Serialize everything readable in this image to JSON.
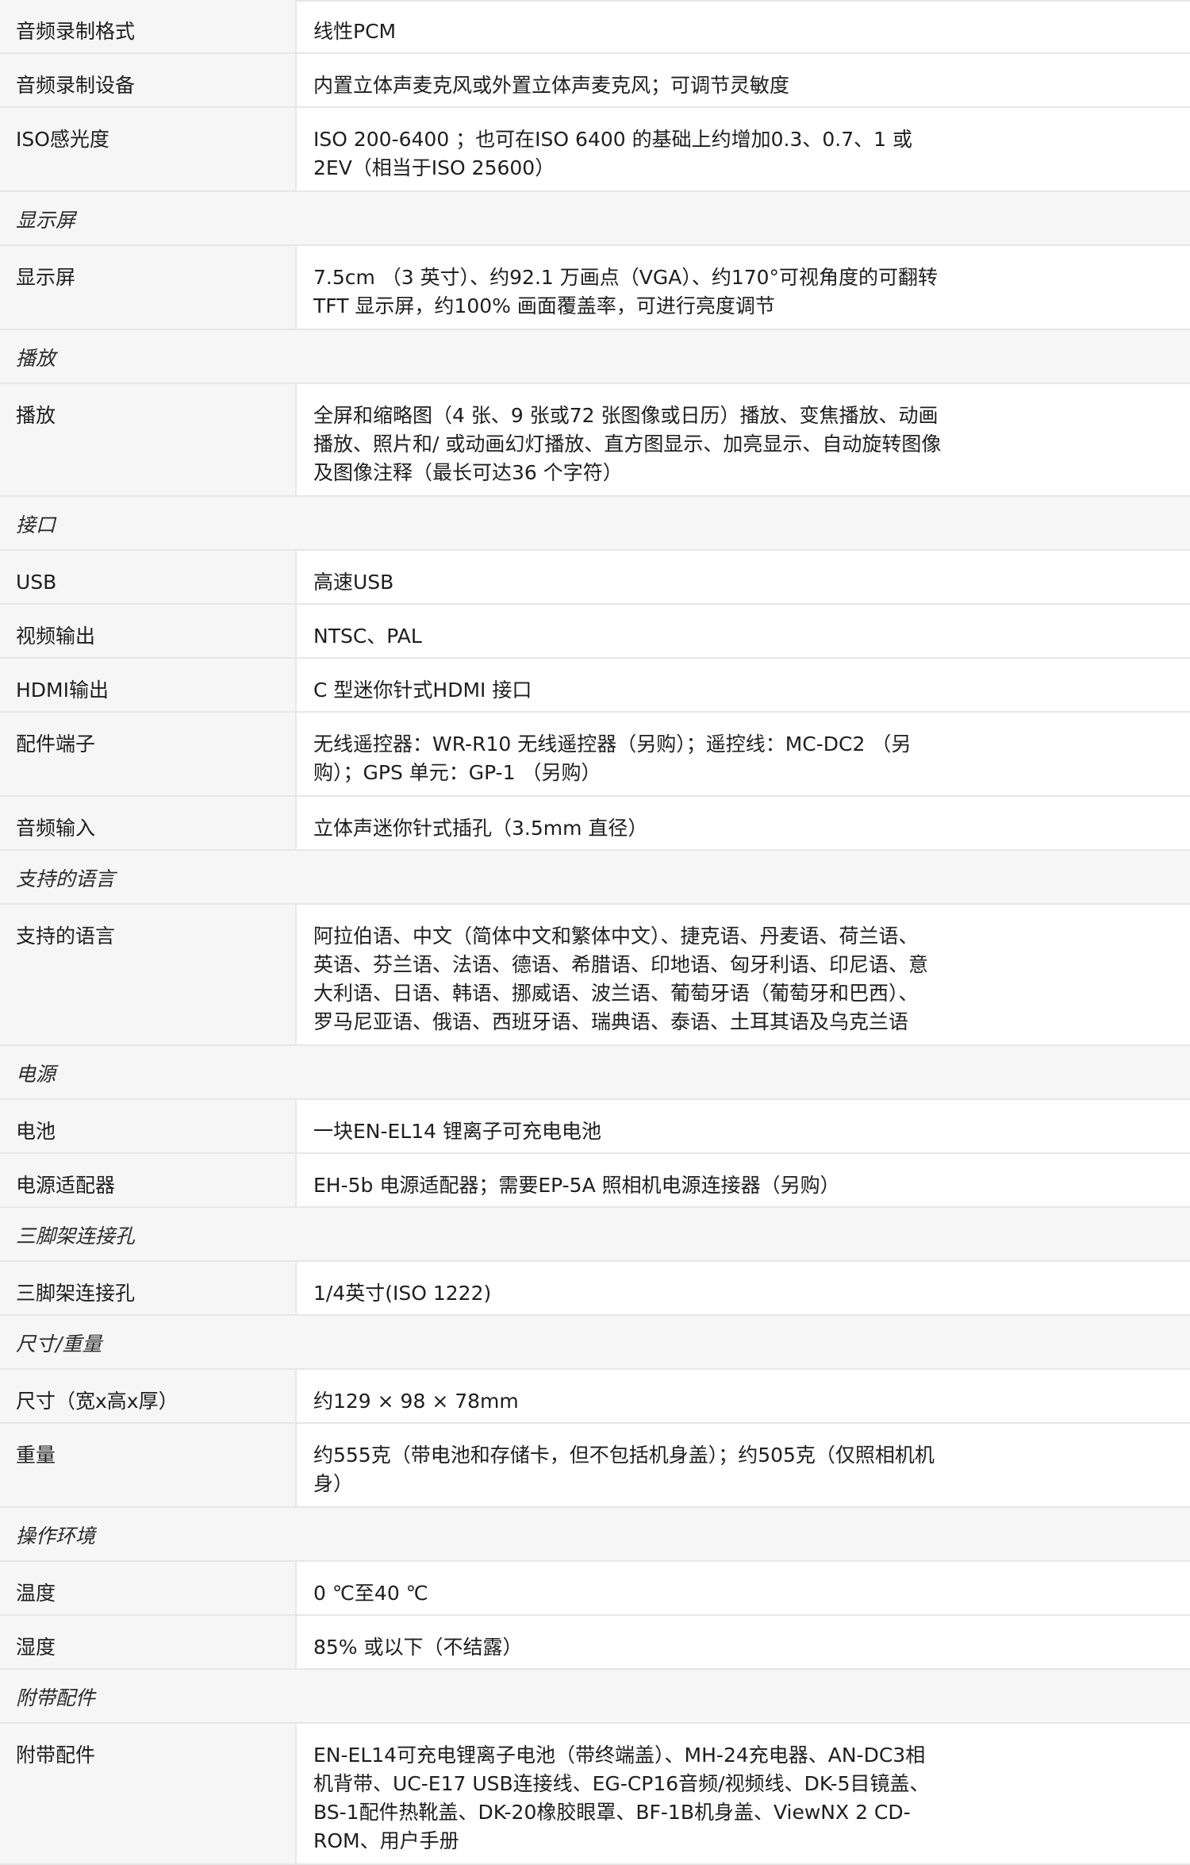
{
  "rows": [
    {
      "kind": "spec",
      "label": "音频录制格式",
      "lines": [
        "线性PCM"
      ]
    },
    {
      "kind": "spec",
      "label": "音频录制设备",
      "lines": [
        "内置立体声麦克风或外置立体声麦克风；可调节灵敏度"
      ]
    },
    {
      "kind": "spec",
      "label": "ISO感光度",
      "lines": [
        "ISO 200-6400 ；也可在ISO 6400 的基础上约增加0.3、0.7、1 或",
        "2EV（相当于ISO 25600）"
      ]
    },
    {
      "kind": "section",
      "title": "显示屏"
    },
    {
      "kind": "spec",
      "label": "显示屏",
      "lines": [
        "7.5cm （3 英寸）、约92.1 万画点（VGA）、约170°可视角度的可翻转",
        "TFT 显示屏，约100% 画面覆盖率，可进行亮度调节"
      ]
    },
    {
      "kind": "section",
      "title": "播放"
    },
    {
      "kind": "spec",
      "label": "播放",
      "lines": [
        "全屏和缩略图（4 张、9 张或72 张图像或日历）播放、变焦播放、动画",
        "播放、照片和/ 或动画幻灯播放、直方图显示、加亮显示、自动旋转图像",
        "及图像注释（最长可达36 个字符）"
      ]
    },
    {
      "kind": "section",
      "title": "接口"
    },
    {
      "kind": "spec",
      "label": "USB",
      "lines": [
        "高速USB"
      ]
    },
    {
      "kind": "spec",
      "label": "视频输出",
      "lines": [
        "NTSC、PAL"
      ]
    },
    {
      "kind": "spec",
      "label": "HDMI输出",
      "lines": [
        "C 型迷你针式HDMI 接口"
      ]
    },
    {
      "kind": "spec",
      "label": "配件端子",
      "lines": [
        "无线遥控器：WR-R10 无线遥控器（另购）；遥控线：MC-DC2 （另",
        "购）；GPS 单元：GP-1 （另购）"
      ]
    },
    {
      "kind": "spec",
      "label": "音频输入",
      "lines": [
        "立体声迷你针式插孔（3.5mm 直径）"
      ]
    },
    {
      "kind": "section",
      "title": "支持的语言"
    },
    {
      "kind": "spec",
      "label": "支持的语言",
      "lines": [
        "阿拉伯语、中文（简体中文和繁体中文）、捷克语、丹麦语、荷兰语、",
        "英语、芬兰语、法语、德语、希腊语、印地语、匈牙利语、印尼语、意",
        "大利语、日语、韩语、挪威语、波兰语、葡萄牙语（葡萄牙和巴西）、",
        "罗马尼亚语、俄语、西班牙语、瑞典语、泰语、土耳其语及乌克兰语"
      ]
    },
    {
      "kind": "section",
      "title": "电源"
    },
    {
      "kind": "spec",
      "label": "电池",
      "lines": [
        "一块EN-EL14 锂离子可充电电池"
      ]
    },
    {
      "kind": "spec",
      "label": "电源适配器",
      "lines": [
        "EH-5b 电源适配器；需要EP-5A 照相机电源连接器（另购）"
      ]
    },
    {
      "kind": "section",
      "title": "三脚架连接孔"
    },
    {
      "kind": "spec",
      "label": "三脚架连接孔",
      "lines": [
        "1/4英寸(ISO 1222)"
      ]
    },
    {
      "kind": "section",
      "title": "尺寸/重量"
    },
    {
      "kind": "spec",
      "label": "尺寸（宽x高x厚）",
      "lines": [
        "约129 × 98 × 78mm"
      ]
    },
    {
      "kind": "spec",
      "label": "重量",
      "lines": [
        "约555克（带电池和存储卡，但不包括机身盖）；约505克（仅照相机机",
        "身）"
      ]
    },
    {
      "kind": "section",
      "title": "操作环境"
    },
    {
      "kind": "spec",
      "label": "温度",
      "lines": [
        "0 ℃至40 ℃"
      ]
    },
    {
      "kind": "spec",
      "label": "湿度",
      "lines": [
        "85% 或以下（不结露）"
      ]
    },
    {
      "kind": "section",
      "title": "附带配件"
    },
    {
      "kind": "spec",
      "label": "附带配件",
      "lines": [
        "EN-EL14可充电锂离子电池（带终端盖）、MH-24充电器、AN-DC3相",
        "机背带、UC-E17 USB连接线、EG-CP16音频/视频线、DK-5目镜盖、",
        "BS-1配件热靴盖、DK-20橡胶眼罩、BF-1B机身盖、ViewNX 2 CD-",
        "ROM、用户手册"
      ]
    }
  ]
}
